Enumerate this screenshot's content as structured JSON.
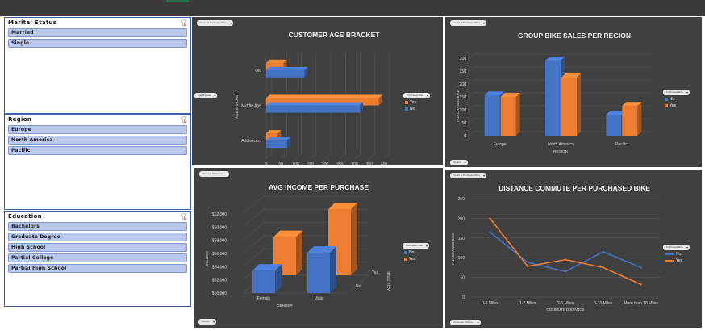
{
  "colors": {
    "no": "#4472c4",
    "yes": "#ed7d31",
    "panel": "#404040",
    "slicer_item": "#b8c8ec"
  },
  "slicers": {
    "marital": {
      "title": "Marital Status",
      "items": [
        "Married",
        "Single"
      ]
    },
    "region": {
      "title": "Region",
      "items": [
        "Europe",
        "North America",
        "Pacific"
      ]
    },
    "education": {
      "title": "Education",
      "items": [
        "Bachelors",
        "Graduate Degree",
        "High School",
        "Partial College",
        "Partial High School"
      ]
    }
  },
  "charts": {
    "age": {
      "title": "CUSTOMER AGE BRACKET",
      "pill_top": "Count of Purchased Bike",
      "pill_left": "Age Bracket",
      "pill_legend": "Purchased Bike",
      "legend": [
        "Yes",
        "No"
      ]
    },
    "region": {
      "title": "GROUP BIKE SALES PER REGION",
      "pill_top": "Count of Purchased Bike",
      "pill_bottom": "Region",
      "pill_legend": "Purchased Bike",
      "legend": [
        "No",
        "Yes"
      ]
    },
    "income": {
      "title": "AVG INCOME PER PURCHASE",
      "pill_top": "Average of Income",
      "pill_bottom": "Gender",
      "pill_legend": "Purchased Bike",
      "legend": [
        "No",
        "Yes"
      ]
    },
    "commute": {
      "title": "DISTANCE COMMUTE PER PURCHASED BIKE",
      "pill_top": "Count of Purchased Bike",
      "pill_bottom": "Commute Distance",
      "pill_legend": "Purchased Bike",
      "legend": [
        "No",
        "Yes"
      ]
    }
  },
  "chart_data": [
    {
      "type": "bar",
      "title": "CUSTOMER AGE BRACKET",
      "xlabel": "PURCHASED BIKE",
      "ylabel": "AGE BRACKET",
      "categories": [
        "Adolescent",
        "Middle Age",
        "Old"
      ],
      "series": [
        {
          "name": "No",
          "values": [
            71,
            318,
            130
          ]
        },
        {
          "name": "Yes",
          "values": [
            39,
            383,
            59
          ]
        }
      ],
      "xlim": [
        0,
        400
      ],
      "ticks": [
        "0",
        "50",
        "100",
        "150",
        "200",
        "250",
        "300",
        "350",
        "400"
      ],
      "legend": "right"
    },
    {
      "type": "bar",
      "title": "GROUP BIKE SALES PER REGION",
      "xlabel": "REGION",
      "ylabel": "PURCHASED BIKE",
      "categories": [
        "Europe",
        "North America",
        "Pacific"
      ],
      "series": [
        {
          "name": "No",
          "values": [
            155,
            290,
            80
          ]
        },
        {
          "name": "Yes",
          "values": [
            150,
            225,
            115
          ]
        }
      ],
      "ylim": [
        0,
        300
      ],
      "ticks": [
        "0",
        "50",
        "100",
        "150",
        "200",
        "250",
        "300"
      ],
      "legend": "right"
    },
    {
      "type": "bar",
      "title": "AVG INCOME PER PURCHASE",
      "xlabel": "GENDER",
      "ylabel": "INCOME",
      "zlabel": "AXIS TITLE",
      "categories": [
        "Female",
        "Male"
      ],
      "depth_labels": [
        "No",
        "Yes"
      ],
      "series": [
        {
          "name": "No",
          "values": [
            53400,
            56100
          ]
        },
        {
          "name": "Yes",
          "values": [
            55800,
            60000
          ]
        }
      ],
      "ylim": [
        50000,
        62000
      ],
      "ticks": [
        "$50,000",
        "$52,000",
        "$54,000",
        "$56,000",
        "$58,000",
        "$60,000",
        "$62,000"
      ],
      "legend": "right"
    },
    {
      "type": "line",
      "title": "DISTANCE COMMUTE PER PURCHASED BIKE",
      "xlabel": "COMMUTE DISTANCE",
      "ylabel": "PURCHASED BIKE",
      "categories": [
        "0-1 Miles",
        "1-2 Miles",
        "2-5 Miles",
        "5-10 Miles",
        "More than 10 Miles"
      ],
      "series": [
        {
          "name": "No",
          "values": [
            165,
            88,
            65,
            115,
            75
          ]
        },
        {
          "name": "Yes",
          "values": [
            200,
            78,
            95,
            75,
            32
          ]
        }
      ],
      "ylim": [
        0,
        250
      ],
      "ticks": [
        "0",
        "50",
        "100",
        "150",
        "200",
        "250"
      ],
      "legend": "right"
    }
  ]
}
